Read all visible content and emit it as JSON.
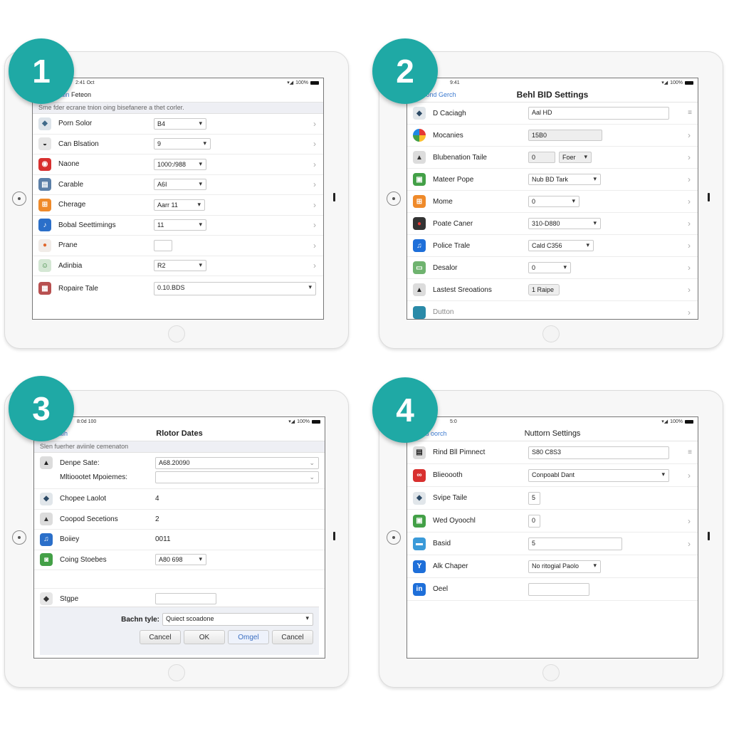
{
  "badges": [
    "1",
    "2",
    "3",
    "4"
  ],
  "panels": [
    {
      "status": {
        "left": "2:41 Oct",
        "right": "100%"
      },
      "nav_back": "Rreanoain",
      "nav_back_tail": "Feteon",
      "title": "",
      "hint": "Sme fder ecrane tnion oing bisefanere a thet corler.",
      "rows": [
        {
          "label": "Porn Solor",
          "value": "B4",
          "control": "dropdown",
          "chevron": true
        },
        {
          "label": "Can Blsation",
          "value": "9",
          "control": "dropdown",
          "chevron": true
        },
        {
          "label": "Naone",
          "value": "1000:/988",
          "control": "dropdown",
          "chevron": true
        },
        {
          "label": "Carable",
          "value": "A6I",
          "control": "dropdown",
          "chevron": true
        },
        {
          "label": "Cherage",
          "value": "Aarr 11",
          "control": "dropdown",
          "chevron": true
        },
        {
          "label": "Bobal Seettimings",
          "value": "11",
          "control": "dropdown",
          "chevron": true
        },
        {
          "label": "Prane",
          "value": "",
          "control": "text",
          "chevron": true
        },
        {
          "label": "Adinbia",
          "value": "R2",
          "control": "dropdown",
          "chevron": true
        },
        {
          "label": "Ropaire Tale",
          "value": "0.10.BDS",
          "control": "dropdown-wide",
          "chevron": false
        }
      ]
    },
    {
      "status": {
        "left": "9:41",
        "right": "100%"
      },
      "nav_back": "Reeond Gerch",
      "title": "Behl BID Settings",
      "rows": [
        {
          "label": "D Caciagh",
          "value": "Aal HD",
          "control": "text-wide",
          "trailing": "grip"
        },
        {
          "label": "Mocanies",
          "value": "15B0",
          "control": "gray",
          "trailing": "chevron"
        },
        {
          "label": "Blubenation Taile",
          "value": "0",
          "value2": "Foer",
          "control": "split",
          "trailing": "chevron"
        },
        {
          "label": "Mateer Pope",
          "value": "Nub BD Tark",
          "control": "dropdown",
          "trailing": "chevron"
        },
        {
          "label": "Mome",
          "value": "0",
          "control": "dropdown",
          "trailing": "chevron"
        },
        {
          "label": "Poate Caner",
          "value": "310-D880",
          "control": "dropdown",
          "trailing": "chevron"
        },
        {
          "label": "Police Trale",
          "value": "Cald C356",
          "control": "dropdown",
          "trailing": "chevron"
        },
        {
          "label": "Desalor",
          "value": "0",
          "control": "dropdown",
          "trailing": "chevron"
        },
        {
          "label": "Lastest Sreoations",
          "value": "1 Raipe",
          "control": "button",
          "trailing": "chevron"
        },
        {
          "label": "Dutton",
          "value": "",
          "control": "none",
          "trailing": "chevron"
        }
      ]
    },
    {
      "status": {
        "left": "8:0d 100",
        "right": "100%"
      },
      "nav_back": "Mtnonaih",
      "title": "Rlotor Dates",
      "hint": "Slen fuerher aviinle cemenaton",
      "rows": [
        {
          "label": "Denpe Sate:",
          "value": "A68.20090",
          "control": "combo"
        },
        {
          "label": "Mltioootet Mpoiemes:",
          "value": "",
          "control": "combo"
        },
        {
          "label": "Chopee Laolot",
          "value": "4",
          "control": "plain"
        },
        {
          "label": "Coopod Secetions",
          "value": "2",
          "control": "plain"
        },
        {
          "label": "Boiiey",
          "value": "0011",
          "control": "plain"
        },
        {
          "label": "Coing Stoebes",
          "value": "A80 698",
          "control": "dropdown"
        },
        {
          "label": "Stgpe",
          "value": "",
          "control": "text"
        }
      ],
      "footer": {
        "label": "Bachn tyle:",
        "select_value": "Quiect scoadone",
        "buttons": [
          "Cancel",
          "OK",
          "Omgel",
          "Cancel"
        ]
      }
    },
    {
      "status": {
        "left": "5:0",
        "right": "100%"
      },
      "nav_back": "Sited oorch",
      "title": "Nuttorn Settings",
      "rows": [
        {
          "label": "Rind Bll Pimnect",
          "value": "S80 C8S3",
          "control": "text-wide",
          "trailing": "grip"
        },
        {
          "label": "Blieoooth",
          "value": "Conpoabl Dant",
          "control": "dropdown-wide",
          "trailing": "chevron"
        },
        {
          "label": "Svipe Taile",
          "value": "5",
          "control": "small",
          "trailing": "none"
        },
        {
          "label": "Wed Oyoochl",
          "value": "0",
          "control": "small",
          "trailing": "chevron"
        },
        {
          "label": "Basid",
          "value": "5",
          "control": "text",
          "trailing": "chevron"
        },
        {
          "label": "Alk Chaper",
          "value": "No ritogial Paolo",
          "control": "dropdown",
          "trailing": "none"
        },
        {
          "label": "Oeel",
          "value": "",
          "control": "text",
          "trailing": "none"
        }
      ]
    }
  ],
  "colors": {
    "badge": "#1fa9a5",
    "link": "#3b7ad0"
  }
}
